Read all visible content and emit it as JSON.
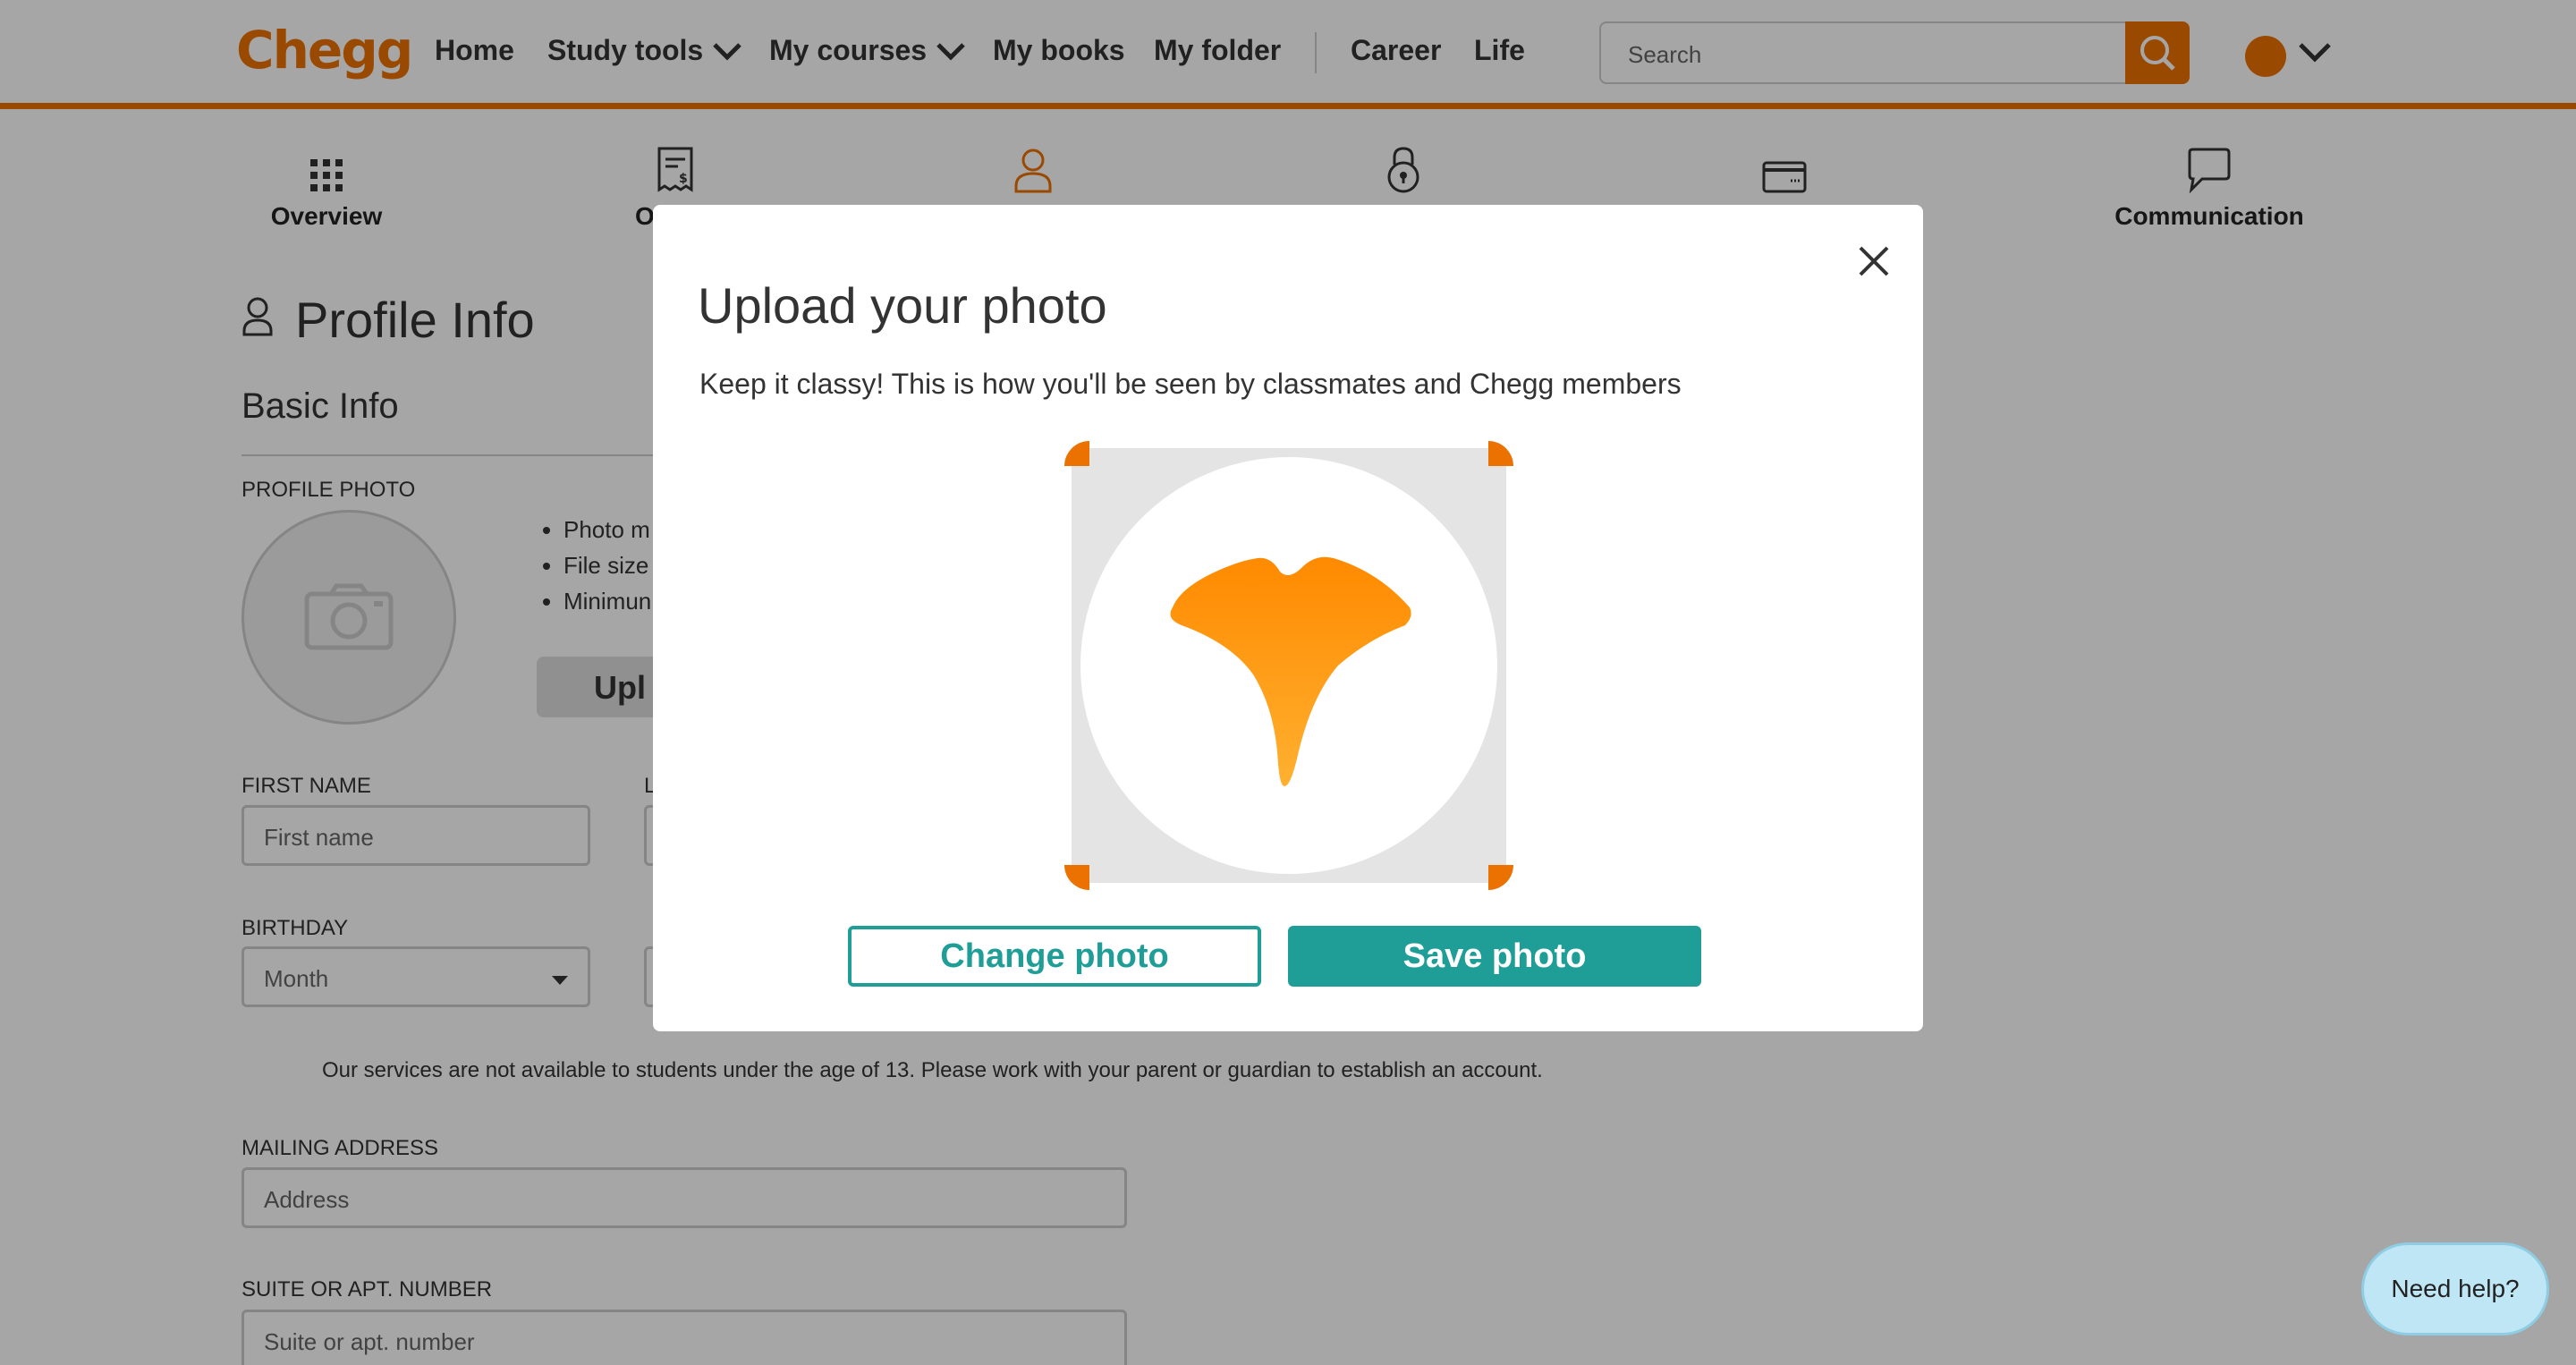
{
  "nav": {
    "logo": "Chegg",
    "items": [
      "Home",
      "Study tools",
      "My courses",
      "My books",
      "My folder",
      "Career",
      "Life"
    ],
    "search_placeholder": "Search"
  },
  "tabs": [
    {
      "label": "Overview",
      "icon": "grid-icon"
    },
    {
      "label": "O",
      "icon": "receipt-icon"
    },
    {
      "label": "",
      "icon": "person-icon"
    },
    {
      "label": "",
      "icon": "lock-icon"
    },
    {
      "label": "",
      "icon": "credit-card-icon"
    },
    {
      "label": "Communication",
      "icon": "chat-icon"
    }
  ],
  "page": {
    "title": "Profile Info",
    "section": "Basic Info",
    "profile_photo_label": "PROFILE PHOTO",
    "bullets": [
      "Photo m",
      "File size",
      "Minimun"
    ],
    "upload_label": "Upl",
    "first_name_label": "FIRST NAME",
    "first_name_placeholder": "First name",
    "last_name_label_partial": "L",
    "birthday_label": "BIRTHDAY",
    "month_placeholder": "Month",
    "age_note": "Our services are not available to students under the age of 13. Please work with your parent or guardian to establish an account.",
    "mailing_label": "MAILING ADDRESS",
    "address_placeholder": "Address",
    "suite_label": "SUITE OR APT. NUMBER",
    "suite_placeholder": "Suite or apt. number"
  },
  "modal": {
    "title": "Upload your photo",
    "subtitle": "Keep it classy! This is how you'll be seen by classmates and Chegg members",
    "change_label": "Change photo",
    "save_label": "Save photo"
  },
  "help": {
    "label": "Need help?"
  },
  "colors": {
    "brand": "#eb7100",
    "teal": "#1f9e97"
  }
}
